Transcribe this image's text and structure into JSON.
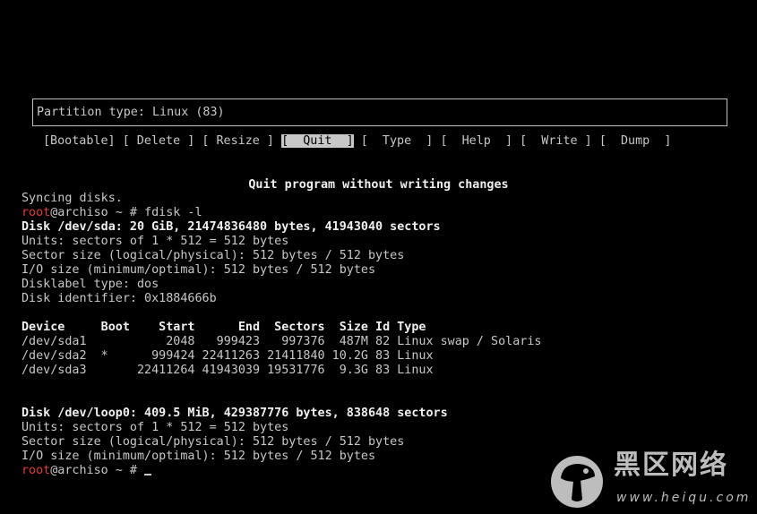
{
  "partition_box": {
    "text": "Partition type: Linux (83)"
  },
  "menu": {
    "items": [
      {
        "label": "[Bootable]"
      },
      {
        "label": "[ Delete ]"
      },
      {
        "label": "[ Resize ]"
      },
      {
        "label": "[  Quit  ]",
        "selected": true
      },
      {
        "label": "[  Type  ]"
      },
      {
        "label": "[  Help  ]"
      },
      {
        "label": "[  Write ]"
      },
      {
        "label": "[  Dump  ]"
      }
    ],
    "description": "Quit program without writing changes"
  },
  "terminal": {
    "syncing": "Syncing disks.",
    "prompt_user": "root",
    "prompt_host": "@archiso ~ # ",
    "command": "fdisk -l",
    "disk1": {
      "header": "Disk /dev/sda: 20 GiB, 21474836480 bytes, 41943040 sectors",
      "units": "Units: sectors of 1 * 512 = 512 bytes",
      "sector_size": "Sector size (logical/physical): 512 bytes / 512 bytes",
      "io_size": "I/O size (minimum/optimal): 512 bytes / 512 bytes",
      "label_type": "Disklabel type: dos",
      "identifier": "Disk identifier: 0x1884666b"
    },
    "partition_table": {
      "header": "Device     Boot    Start      End  Sectors  Size Id Type",
      "rows": [
        "/dev/sda1           2048   999423   997376  487M 82 Linux swap / Solaris",
        "/dev/sda2  *      999424 22411263 21411840 10.2G 83 Linux",
        "/dev/sda3       22411264 41943039 19531776  9.3G 83 Linux"
      ]
    },
    "disk2": {
      "header": "Disk /dev/loop0: 409.5 MiB, 429387776 bytes, 838648 sectors",
      "units": "Units: sectors of 1 * 512 = 512 bytes",
      "sector_size": "Sector size (logical/physical): 512 bytes / 512 bytes",
      "io_size": "I/O size (minimum/optimal): 512 bytes / 512 bytes"
    }
  },
  "watermark": {
    "text": "黑区网络",
    "url": "www.heiqu.com"
  },
  "colors": {
    "background": "#000000",
    "foreground": "#c8c8c8",
    "prompt_user": "#e03a3a"
  }
}
